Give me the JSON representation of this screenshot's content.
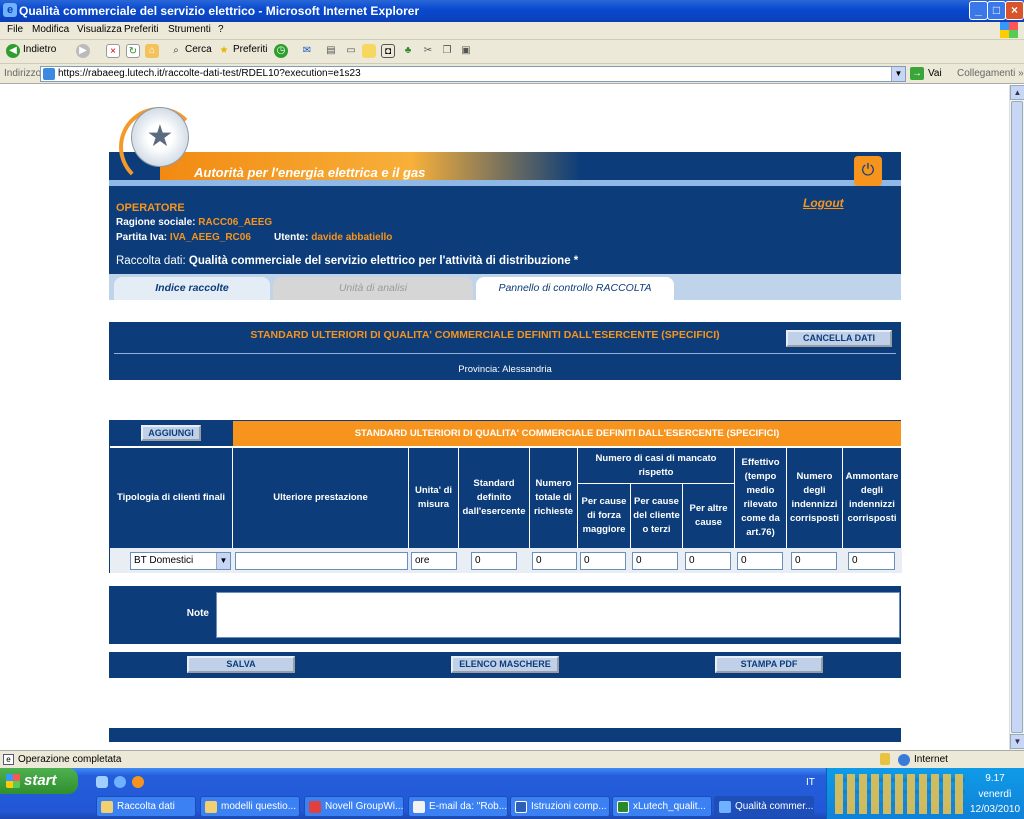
{
  "window": {
    "title": "Qualità commerciale del servizio elettrico - Microsoft Internet Explorer",
    "controls": [
      "_",
      "□",
      "×"
    ]
  },
  "menu": [
    "File",
    "Modifica",
    "Visualizza",
    "Preferiti",
    "Strumenti",
    "?"
  ],
  "toolbar": {
    "back": "Indietro",
    "search": "Cerca",
    "favorites": "Preferiti"
  },
  "address": {
    "label": "Indirizzo",
    "url": "https://rabaeeg.lutech.it/raccolte-dati-test/RDEL10?execution=e1s23",
    "go": "Vai",
    "links": "Collegamenti"
  },
  "banner": {
    "authority": "Autorità per l'energia elettrica e il gas"
  },
  "operator": {
    "heading": "OPERATORE",
    "ragione_label": "Ragione sociale:",
    "ragione_value": "RACC06_AEEG",
    "piva_label": "Partita Iva:",
    "piva_value": "IVA_AEEG_RC06",
    "user_label": "Utente:",
    "user_value": "davide abbatiello",
    "logout": "Logout",
    "raccolta_label": "Raccolta dati:",
    "raccolta_value": "Qualità commerciale del servizio elettrico per l'attività di distribuzione *"
  },
  "tabs": [
    "Indice raccolte",
    "Unità di analisi",
    "Pannello di controllo RACCOLTA"
  ],
  "section": {
    "title": "STANDARD ULTERIORI DI QUALITA' COMMERCIALE DEFINITI DALL'ESERCENTE (SPECIFICI)",
    "cancel": "CANCELLA DATI",
    "provincia": "Provincia: Alessandria"
  },
  "table": {
    "add_button": "AGGIUNGI",
    "title": "STANDARD ULTERIORI DI QUALITA' COMMERCIALE DEFINITI DALL'ESERCENTE (SPECIFICI)",
    "headers": {
      "tipologia": "Tipologia di clienti finali",
      "prestazione": "Ulteriore prestazione",
      "unita": "Unita' di misura",
      "standard": "Standard definito dall'esercente",
      "richieste": "Numero totale di richieste",
      "mancato": "Numero di casi di mancato rispetto",
      "forza": "Per cause di forza maggiore",
      "cliente": "Per cause del cliente o terzi",
      "altre": "Per altre cause",
      "effettivo": "Effettivo (tempo medio rilevato come da art.76)",
      "indennizzi": "Numero degli indennizzi corrisposti",
      "ammontare": "Ammontare degli indennizzi corrisposti"
    },
    "row": {
      "tipologia": "BT Domestici",
      "prestazione": "",
      "unita": "ore",
      "standard": "0",
      "richieste": "0",
      "forza": "0",
      "cliente": "0",
      "altre": "0",
      "effettivo": "0",
      "indennizzi": "0",
      "ammontare": "0"
    },
    "note_label": "Note",
    "note_value": ""
  },
  "actions": {
    "save": "SALVA",
    "list": "ELENCO MASCHERE",
    "print": "STAMPA PDF"
  },
  "status": {
    "text": "Operazione completata",
    "zone": "Internet"
  },
  "taskbar": {
    "start": "start",
    "items": [
      "Raccolta dati",
      "modelli questio...",
      "Novell GroupWi...",
      "E-mail da: \"Rob...",
      "Istruzioni comp...",
      "xLutech_qualit...",
      "Qualità commer..."
    ],
    "lang": "IT",
    "time": "9.17",
    "day": "venerdì",
    "date": "12/03/2010"
  }
}
